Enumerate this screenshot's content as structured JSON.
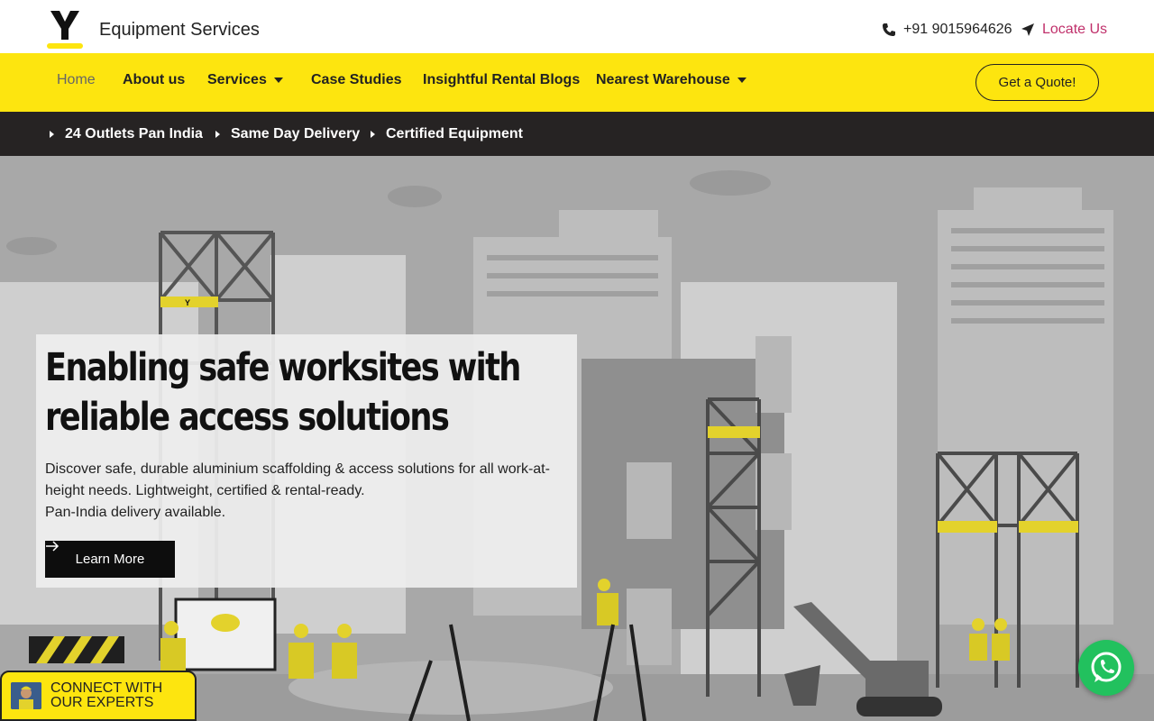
{
  "brand": {
    "logo_letter": "Y",
    "name": "Equipment Services"
  },
  "contact": {
    "phone": "+91 9015964626",
    "locate_label": "Locate Us"
  },
  "nav": {
    "items": [
      {
        "label": "Home",
        "active": true
      },
      {
        "label": "About us"
      },
      {
        "label": "Services",
        "dropdown": true
      },
      {
        "label": "Case Studies"
      },
      {
        "label": "Insightful Rental Blogs"
      },
      {
        "label": "Nearest Warehouse",
        "dropdown": true
      }
    ],
    "quote_button": "Get a Quote!"
  },
  "features": [
    "24 Outlets Pan India",
    "Same Day Delivery",
    "Certified Equipment"
  ],
  "hero": {
    "title_line1": "Enabling safe worksites with",
    "title_line2": "reliable access solutions",
    "desc_line1": "Discover safe, durable aluminium scaffolding & access solutions for all work-at-",
    "desc_line2": "height needs. Lightweight, certified & rental-ready.",
    "desc_line3": "Pan-India delivery available.",
    "cta": "Learn More",
    "scaffold_badge": "Y"
  },
  "floating": {
    "connect_line1": "CONNECT WITH",
    "connect_line2": "OUR EXPERTS"
  },
  "colors": {
    "yellow": "#fde50f",
    "dark": "#262323",
    "accent_pink": "#c0306b",
    "whatsapp": "#22c15e"
  }
}
